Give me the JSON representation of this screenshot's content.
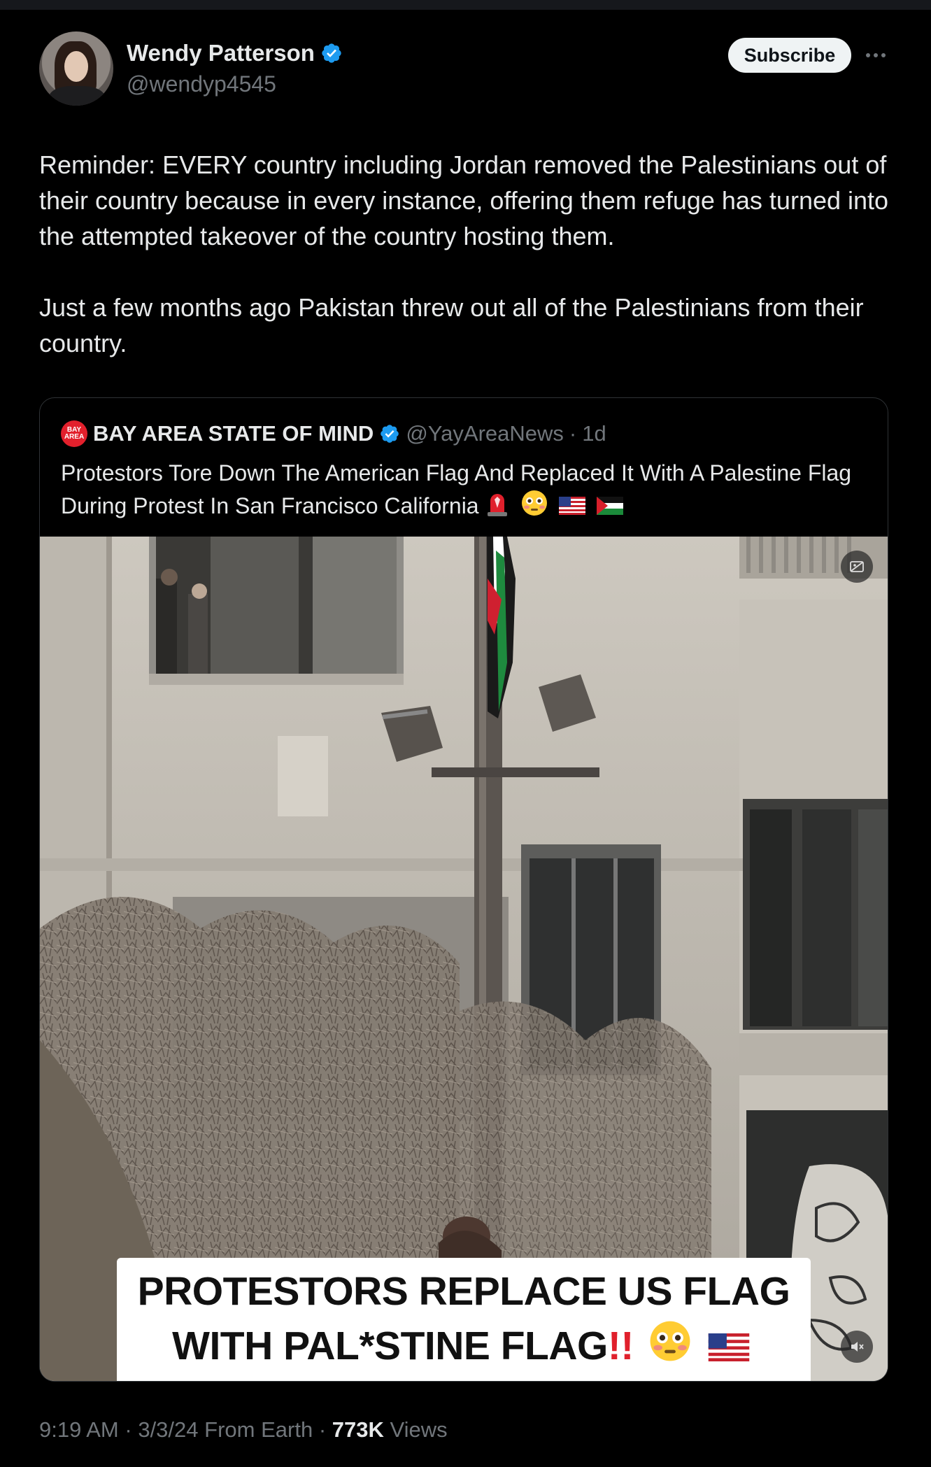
{
  "author": {
    "display_name": "Wendy Patterson",
    "handle": "@wendyp4545",
    "verified_icon": "verified-badge-icon",
    "avatar_icon": "profile-photo"
  },
  "header": {
    "subscribe_label": "Subscribe",
    "more_icon": "more-horizontal-icon"
  },
  "tweet": {
    "paragraph_1": "Reminder: EVERY country including Jordan removed the Palestinians out of their country because in every instance, offering them refuge has turned into the attempted takeover of the country hosting them.",
    "paragraph_2": "Just a few months ago Pakistan threw out all of the Palestinians from their country."
  },
  "quote": {
    "logo_text_1": "BAY",
    "logo_text_2": "AREA",
    "display_name": "BAY AREA STATE OF MIND",
    "handle": "@YayAreaNews",
    "separator": "·",
    "age": "1d",
    "text": "Protestors Tore Down The American Flag And Replaced It With A Palestine Flag During Protest In San Francisco California",
    "emojis": [
      "rotating-light-emoji",
      "flushed-face-emoji",
      "us-flag-emoji",
      "palestine-flag-emoji"
    ]
  },
  "video": {
    "caption_line_1": "PROTESTORS REPLACE US FLAG",
    "caption_line_2": "WITH PAL*STINE FLAG",
    "caption_bang": "!!",
    "caption_emojis": [
      "flushed-face-emoji",
      "us-flag-emoji"
    ],
    "top_right_icon": "sensitive-media-icon",
    "bottom_right_icon": "muted-speaker-icon"
  },
  "meta": {
    "time": "9:19 AM",
    "sep1": "·",
    "date": "3/3/24",
    "source": "From Earth",
    "sep2": "·",
    "views_count": "773K",
    "views_label": "Views"
  },
  "colors": {
    "background": "#000000",
    "text": "#e7e9ea",
    "secondary": "#71767b",
    "verified": "#1d9bf0",
    "border": "#2f3336"
  }
}
